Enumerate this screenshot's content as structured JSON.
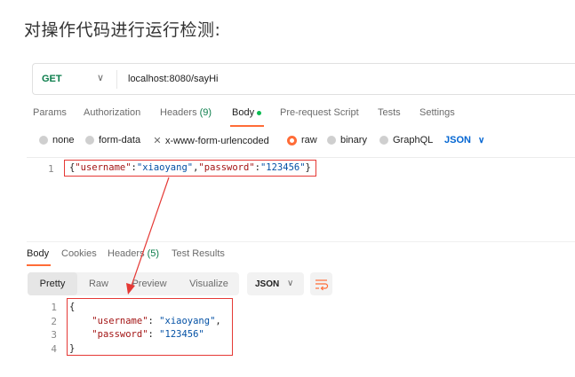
{
  "heading": "对操作代码进行运行检测:",
  "request": {
    "method": "GET",
    "url": "localhost:8080/sayHi"
  },
  "request_tabs": [
    {
      "label": "Params"
    },
    {
      "label": "Authorization"
    },
    {
      "label": "Headers",
      "count": "(9)"
    },
    {
      "label": "Body"
    },
    {
      "label": "Pre-request Script"
    },
    {
      "label": "Tests"
    },
    {
      "label": "Settings"
    }
  ],
  "body_modes": [
    "none",
    "form-data",
    "x-www-form-urlencoded",
    "raw",
    "binary",
    "GraphQL"
  ],
  "body_format": "JSON",
  "request_body": {
    "line_number": "1",
    "open": "{",
    "key1": "\"username\"",
    "colon": ":",
    "val1": "\"xiaoyang\"",
    "comma": ",",
    "key2": "\"password\"",
    "val2": "\"123456\"",
    "close": "}"
  },
  "response_tabs": [
    {
      "label": "Body"
    },
    {
      "label": "Cookies"
    },
    {
      "label": "Headers",
      "count": "(5)"
    },
    {
      "label": "Test Results"
    }
  ],
  "view_modes": [
    "Pretty",
    "Raw",
    "Preview",
    "Visualize"
  ],
  "response_format": "JSON",
  "response_body": {
    "line_numbers": [
      "1",
      "2",
      "3",
      "4"
    ],
    "line1": "{",
    "key1": "\"username\"",
    "val1": "\"xiaoyang\"",
    "key2": "\"password\"",
    "val2": "\"123456\"",
    "line4": "}"
  },
  "colors": {
    "accent": "#ff6c37",
    "method_get": "#0b7d4b",
    "json_blue": "#0265d2",
    "highlight_box": "#e53935"
  }
}
